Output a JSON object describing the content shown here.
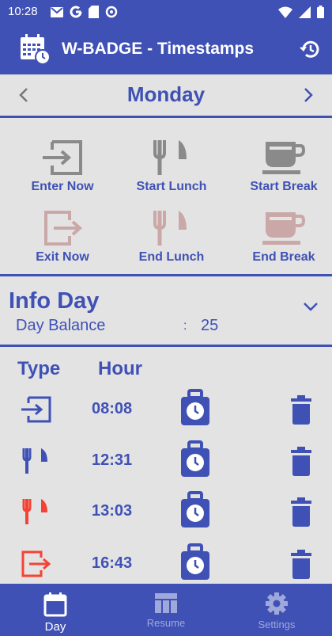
{
  "colors": {
    "primary": "#3f51b5",
    "background": "#e3e3e3",
    "icon_gray": "#8a8a8a",
    "icon_faded": "#cba8a8",
    "red": "#f44336",
    "nav_inactive": "#9fa8da"
  },
  "status_bar": {
    "time": "10:28",
    "icons_left": [
      "gmail-icon",
      "google-icon",
      "sd-card-icon",
      "data-saver-icon"
    ],
    "icons_right": [
      "wifi-icon",
      "signal-icon",
      "battery-icon"
    ]
  },
  "app_bar": {
    "icon": "calendar-clock-icon",
    "title": "W-BADGE - Timestamps",
    "action_icon": "history-icon"
  },
  "day_nav": {
    "day": "Monday",
    "prev_icon": "chevron-left-icon",
    "next_icon": "chevron-right-icon"
  },
  "actions": [
    {
      "label": "Enter Now",
      "icon": "enter-icon",
      "enabled": true
    },
    {
      "label": "Start Lunch",
      "icon": "cutlery-icon",
      "enabled": true
    },
    {
      "label": "Start Break",
      "icon": "coffee-icon",
      "enabled": true
    },
    {
      "label": "Exit Now",
      "icon": "exit-icon",
      "enabled": false
    },
    {
      "label": "End Lunch",
      "icon": "cutlery-icon",
      "enabled": false
    },
    {
      "label": "End Break",
      "icon": "coffee-icon",
      "enabled": false
    }
  ],
  "info_day": {
    "title": "Info Day",
    "balance_label": "Day Balance",
    "separator": ":",
    "balance_value": "25",
    "toggle_icon": "chevron-down-icon"
  },
  "table": {
    "headers": {
      "type": "Type",
      "hour": "Hour"
    },
    "rows": [
      {
        "type": "enter",
        "type_icon": "enter-icon",
        "hour": "08:08"
      },
      {
        "type": "start-lunch",
        "type_icon": "cutlery-icon",
        "hour": "12:31"
      },
      {
        "type": "end-lunch",
        "type_icon": "cutlery-icon",
        "hour": "13:03"
      },
      {
        "type": "exit",
        "type_icon": "exit-icon",
        "hour": "16:43"
      }
    ]
  },
  "bottom_nav": {
    "items": [
      {
        "label": "Day",
        "icon": "calendar-icon",
        "active": true
      },
      {
        "label": "Resume",
        "icon": "table-icon",
        "active": false
      },
      {
        "label": "Settings",
        "icon": "gear-icon",
        "active": false
      }
    ]
  }
}
